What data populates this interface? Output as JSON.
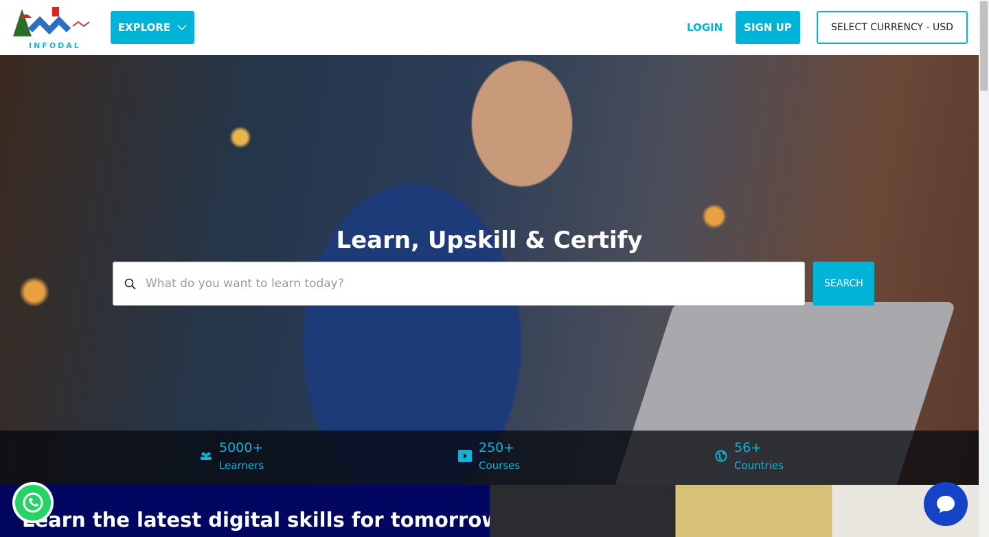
{
  "header": {
    "logo_text": "INFODAL",
    "explore_label": "EXPLORE",
    "login_label": "LOGIN",
    "signup_label": "SIGN UP",
    "currency_label": "SELECT CURRENCY - USD"
  },
  "hero": {
    "title": "Learn, Upskill & Certify",
    "search_placeholder": "What do you want to learn today?",
    "search_button": "SEARCH"
  },
  "stats": [
    {
      "icon": "users-icon",
      "value": "5000+",
      "label": "Learners"
    },
    {
      "icon": "play-icon",
      "value": "250+",
      "label": "Courses"
    },
    {
      "icon": "globe-icon",
      "value": "56+",
      "label": "Countries"
    }
  ],
  "section": {
    "heading": "Learn the latest digital skills for tomorrow's"
  },
  "colors": {
    "accent": "#00b4d8",
    "navy": "#030660",
    "whatsapp": "#25d366",
    "chat": "#1443c8"
  }
}
